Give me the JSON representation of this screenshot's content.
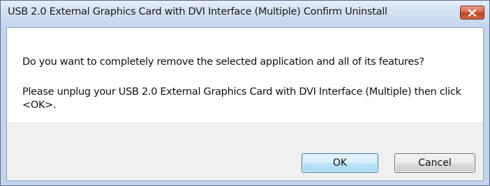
{
  "window": {
    "title": "USB 2.0 External Graphics Card with DVI Interface (Multiple) Confirm Uninstall",
    "close_icon": "close-icon"
  },
  "dialog": {
    "message_1": "Do you want to completely remove the selected application and all of its features?",
    "message_2": "Please unplug your USB 2.0 External Graphics Card with DVI Interface (Multiple) then click <OK>."
  },
  "buttons": {
    "ok_label": "OK",
    "cancel_label": "Cancel"
  },
  "colors": {
    "close_button": "#c2411e",
    "default_button_border": "#3c7fb1",
    "titlebar": "#c4d6ec"
  }
}
